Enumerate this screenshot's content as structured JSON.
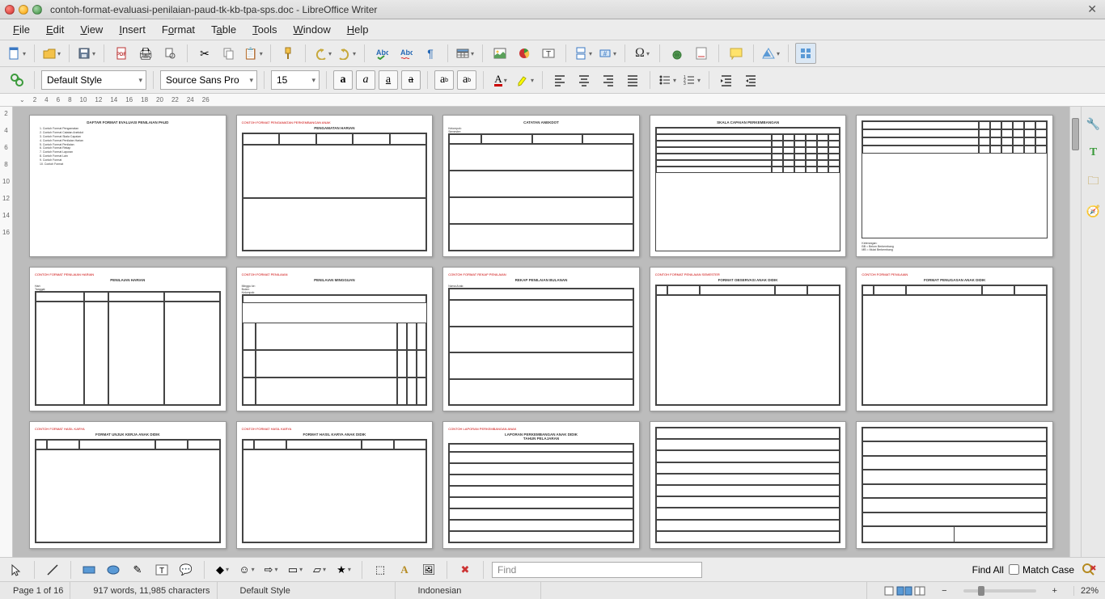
{
  "window": {
    "filename": "contoh-format-evaluasi-penilaian-paud-tk-kb-tpa-sps.doc",
    "app": "LibreOffice Writer"
  },
  "menu": {
    "file": "File",
    "edit": "Edit",
    "view": "View",
    "insert": "Insert",
    "format": "Format",
    "table": "Table",
    "tools": "Tools",
    "window": "Window",
    "help": "Help"
  },
  "formatting": {
    "paragraph_style": "Default Style",
    "font_name": "Source Sans Pro",
    "font_size": "15"
  },
  "find": {
    "placeholder": "Find",
    "find_all": "Find All",
    "match_case": "Match Case"
  },
  "status": {
    "page": "Page 1 of 16",
    "wordcount": "917 words, 11,985 characters",
    "style": "Default Style",
    "language": "Indonesian",
    "zoom": "22%"
  },
  "ruler_marks": [
    "2",
    "4",
    "6",
    "8",
    "10",
    "12",
    "14",
    "16",
    "18",
    "20",
    "22",
    "24",
    "26"
  ],
  "vruler_marks": [
    "2",
    "4",
    "6",
    "8",
    "10",
    "12",
    "14",
    "16"
  ]
}
